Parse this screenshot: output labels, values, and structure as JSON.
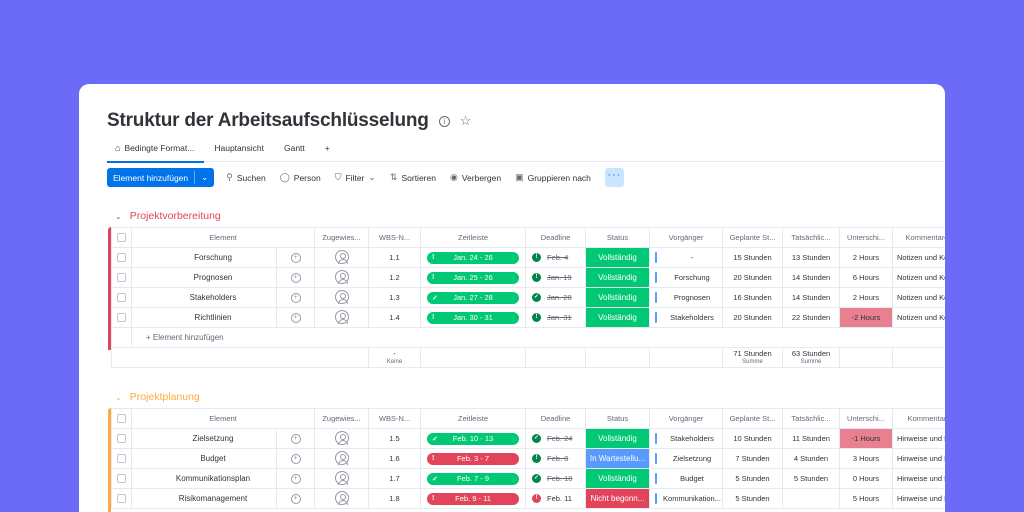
{
  "title": "Struktur der Arbeitsaufschlüsselung",
  "tabs": [
    "Bedingte Format...",
    "Hauptansicht",
    "Gantt",
    "+"
  ],
  "toolbar": {
    "new_item": "Element hinzufügen",
    "search": "Suchen",
    "person": "Person",
    "filter": "Filter",
    "sort": "Sortieren",
    "hide": "Verbergen",
    "group_by": "Gruppieren nach",
    "more": "···"
  },
  "columns": [
    "Element",
    "Zugewies...",
    "WBS-N...",
    "Zeitleiste",
    "Deadline",
    "Status",
    "Vorgänger",
    "Geplante St...",
    "Tatsächlic...",
    "Unterschi...",
    "Kommentar"
  ],
  "columns_g1": [
    "Element",
    "Zugewies...",
    "WBS-N...",
    "Zeitleiste",
    "Deadline",
    "Status",
    "Vorgänger",
    "Geplante St...",
    "Tatsächlic...",
    "Unterschi...",
    "Kommentare"
  ],
  "colors": {
    "green": "#00c875",
    "red": "#e2445c",
    "blue": "#579bfc",
    "status_done": "#00c875",
    "status_waiting": "#579bfc",
    "status_not_started": "#e2445c",
    "diff_negative": "#e8808f",
    "group1": "#e2445c",
    "group2": "#fdab3d",
    "accent": "#0073ea"
  },
  "groups": [
    {
      "title": "Projektvorbereitung",
      "add_label": "+ Element hinzufügen",
      "rows": [
        {
          "name": "Forschung",
          "wbs": "1.1",
          "timeline": "Jan. 24 - 26",
          "tl_icon": "!",
          "tl_color": "#00c875",
          "deadline": "Feb. 4",
          "dl_icon": "!",
          "dl_color": "#323338",
          "status": "Vollständig",
          "status_color": "#00c875",
          "pred": "-",
          "planned": "15 Stunden",
          "actual": "13 Stunden",
          "diff": "2 Hours",
          "diff_neg": false,
          "comment": "Notizen und Ko"
        },
        {
          "name": "Prognosen",
          "wbs": "1.2",
          "timeline": "Jan. 25 - 26",
          "tl_icon": "!",
          "tl_color": "#00c875",
          "deadline": "Jan. 19",
          "dl_icon": "!",
          "dl_color": "#323338",
          "status": "Vollständig",
          "status_color": "#00c875",
          "pred": "Forschung",
          "planned": "20 Stunden",
          "actual": "14 Stunden",
          "diff": "6 Hours",
          "diff_neg": false,
          "comment": "Notizen und Ko"
        },
        {
          "name": "Stakeholders",
          "wbs": "1.3",
          "timeline": "Jan. 27 - 28",
          "tl_icon": "✓",
          "tl_color": "#00c875",
          "deadline": "Jan. 28",
          "dl_icon": "✓",
          "dl_color": "#323338",
          "status": "Vollständig",
          "status_color": "#00c875",
          "pred": "Prognosen",
          "planned": "16 Stunden",
          "actual": "14 Stunden",
          "diff": "2 Hours",
          "diff_neg": false,
          "comment": "Notizen und Ko"
        },
        {
          "name": "Richtlinien",
          "wbs": "1.4",
          "timeline": "Jan. 30 - 31",
          "tl_icon": "!",
          "tl_color": "#00c875",
          "deadline": "Jan. 31",
          "dl_icon": "!",
          "dl_color": "#323338",
          "status": "Vollständig",
          "status_color": "#00c875",
          "pred": "Stakeholders",
          "planned": "20 Stunden",
          "actual": "22 Stunden",
          "diff": "-2 Hours",
          "diff_neg": true,
          "comment": "Notizen und Ko"
        }
      ],
      "summary": {
        "wbs": "Keine",
        "wbs_dash": "-",
        "planned": "71 Stunden",
        "actual": "63 Stunden",
        "sum_label": "Summe"
      }
    },
    {
      "title": "Projektplanung",
      "rows": [
        {
          "name": "Zielsetzung",
          "wbs": "1.5",
          "timeline": "Feb. 10 - 13",
          "tl_icon": "✓",
          "tl_color": "#00c875",
          "deadline": "Feb. 24",
          "dl_icon": "✓",
          "dl_color": "#323338",
          "status": "Vollständig",
          "status_color": "#00c875",
          "pred": "Stakeholders",
          "planned": "10 Stunden",
          "actual": "11 Stunden",
          "diff": "-1 Hours",
          "diff_neg": true,
          "comment": "Hinweise und E"
        },
        {
          "name": "Budget",
          "wbs": "1.6",
          "timeline": "Feb. 3 - 7",
          "tl_icon": "!",
          "tl_color": "#e2445c",
          "deadline": "Feb. 8",
          "dl_icon": "!",
          "dl_color": "#323338",
          "status": "In Wartestellu...",
          "status_color": "#579bfc",
          "pred": "Zielsetzung",
          "planned": "7 Stunden",
          "actual": "4 Stunden",
          "diff": "3 Hours",
          "diff_neg": false,
          "comment": "Hinweise und E"
        },
        {
          "name": "Kommunikationsplan",
          "wbs": "1.7",
          "timeline": "Feb. 7 - 9",
          "tl_icon": "✓",
          "tl_color": "#00c875",
          "deadline": "Feb. 10",
          "dl_icon": "✓",
          "dl_color": "#323338",
          "status": "Vollständig",
          "status_color": "#00c875",
          "pred": "Budget",
          "planned": "5 Stunden",
          "actual": "5 Stunden",
          "diff": "0 Hours",
          "diff_neg": false,
          "comment": "Hinweise und E"
        },
        {
          "name": "Risikomanagement",
          "wbs": "1.8",
          "timeline": "Feb. 9 - 11",
          "tl_icon": "!",
          "tl_color": "#e2445c",
          "deadline": "Feb. 11",
          "dl_icon": "!",
          "dl_color": "#e2445c",
          "status": "Nicht begonn...",
          "status_color": "#e2445c",
          "pred": "Kommunikation...",
          "planned": "5 Stunden",
          "actual": "",
          "diff": "5 Hours",
          "diff_neg": false,
          "comment": "Hinweise und E"
        }
      ]
    }
  ]
}
